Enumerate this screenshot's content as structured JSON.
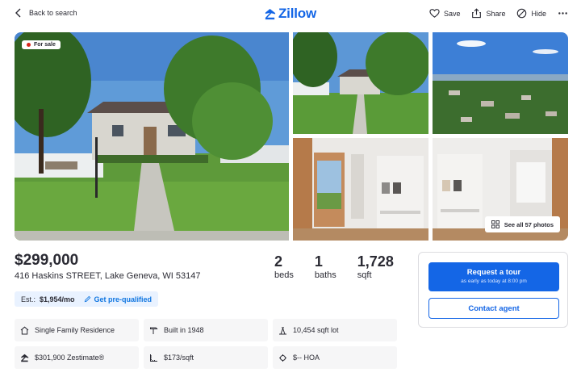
{
  "topbar": {
    "back_label": "Back to search",
    "logo_text": "Zillow",
    "actions": [
      {
        "label": "Save",
        "icon": "heart-icon"
      },
      {
        "label": "Share",
        "icon": "share-icon"
      },
      {
        "label": "Hide",
        "icon": "hide-icon"
      }
    ],
    "more_icon": "more-icon"
  },
  "gallery": {
    "status_badge": "For sale",
    "see_all_label": "See all 57 photos"
  },
  "listing": {
    "price": "$299,000",
    "address": "416 Haskins STREET, Lake Geneva, WI 53147",
    "stats": [
      {
        "value": "2",
        "label": "beds"
      },
      {
        "value": "1",
        "label": "baths"
      },
      {
        "value": "1,728",
        "label": "sqft"
      }
    ],
    "estimate_prefix": "Est.:",
    "estimate_value": "$1,954/mo",
    "prequalify_label": "Get pre-qualified"
  },
  "facts": [
    {
      "text": "Single Family Residence",
      "icon": "house-icon"
    },
    {
      "text": "Built in 1948",
      "icon": "hammer-icon"
    },
    {
      "text": "10,454 sqft lot",
      "icon": "lot-icon"
    },
    {
      "text": "$301,900 Zestimate®",
      "icon": "zestimate-icon"
    },
    {
      "text": "$173/sqft",
      "icon": "ruler-icon"
    },
    {
      "text": "$-- HOA",
      "icon": "hoa-icon"
    }
  ],
  "contact": {
    "tour_label": "Request a tour",
    "tour_sub": "as early as today at 8:00 pm",
    "agent_label": "Contact agent"
  },
  "colors": {
    "brand_blue": "#1466e6",
    "text": "#2a2a33",
    "estimate_bg": "#e9f2ff",
    "fact_bg": "#f6f6f7",
    "sale_dot": "#d9261c"
  }
}
